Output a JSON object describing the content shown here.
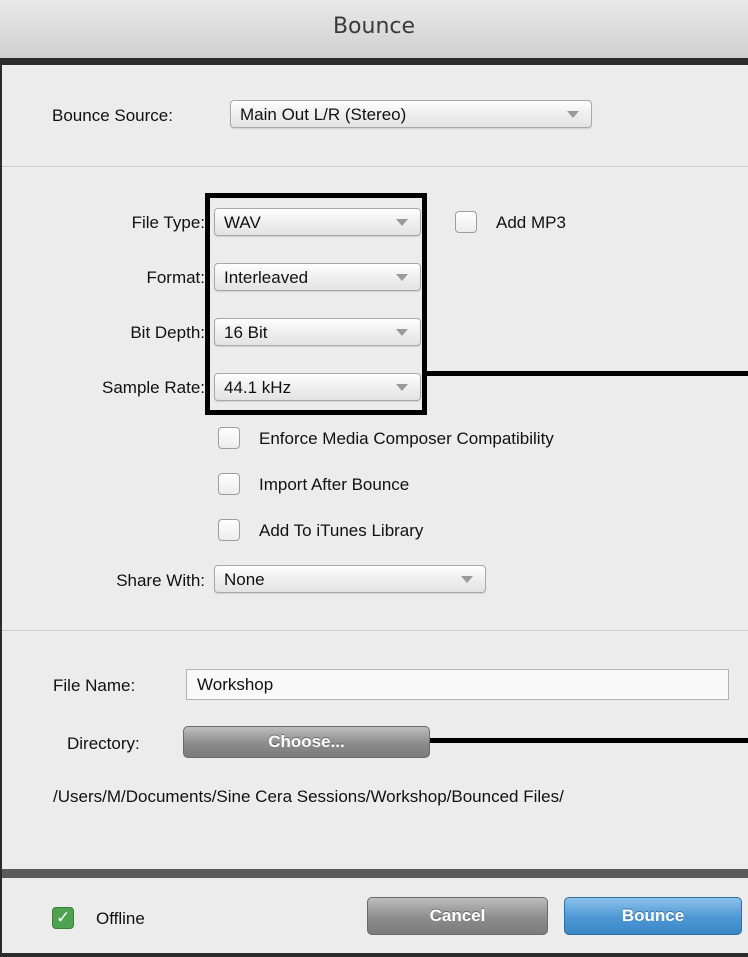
{
  "dialog": {
    "title": "Bounce"
  },
  "source": {
    "label": "Bounce Source:",
    "value": "Main Out L/R (Stereo)"
  },
  "file_settings": {
    "file_type": {
      "label": "File Type:",
      "value": "WAV"
    },
    "add_mp3": {
      "label": "Add MP3",
      "checked": false
    },
    "format": {
      "label": "Format:",
      "value": "Interleaved"
    },
    "bit_depth": {
      "label": "Bit Depth:",
      "value": "16 Bit"
    },
    "sample_rate": {
      "label": "Sample Rate:",
      "value": "44.1 kHz"
    }
  },
  "options": {
    "enforce_compat": {
      "label": "Enforce Media Composer Compatibility",
      "checked": false
    },
    "import_after": {
      "label": "Import After Bounce",
      "checked": false
    },
    "add_itunes": {
      "label": "Add To iTunes Library",
      "checked": false
    }
  },
  "share": {
    "label": "Share With:",
    "value": "None"
  },
  "output": {
    "file_name_label": "File Name:",
    "file_name_value": "Workshop",
    "directory_label": "Directory:",
    "choose_label": "Choose...",
    "path": "/Users/M/Documents/Sine Cera Sessions/Workshop/Bounced Files/"
  },
  "footer": {
    "offline": {
      "label": "Offline",
      "checked": true
    },
    "cancel_label": "Cancel",
    "bounce_label": "Bounce"
  },
  "colors": {
    "accent_blue": "#4c97d3",
    "checkbox_green": "#4ea34e",
    "annotation": "#000000"
  }
}
